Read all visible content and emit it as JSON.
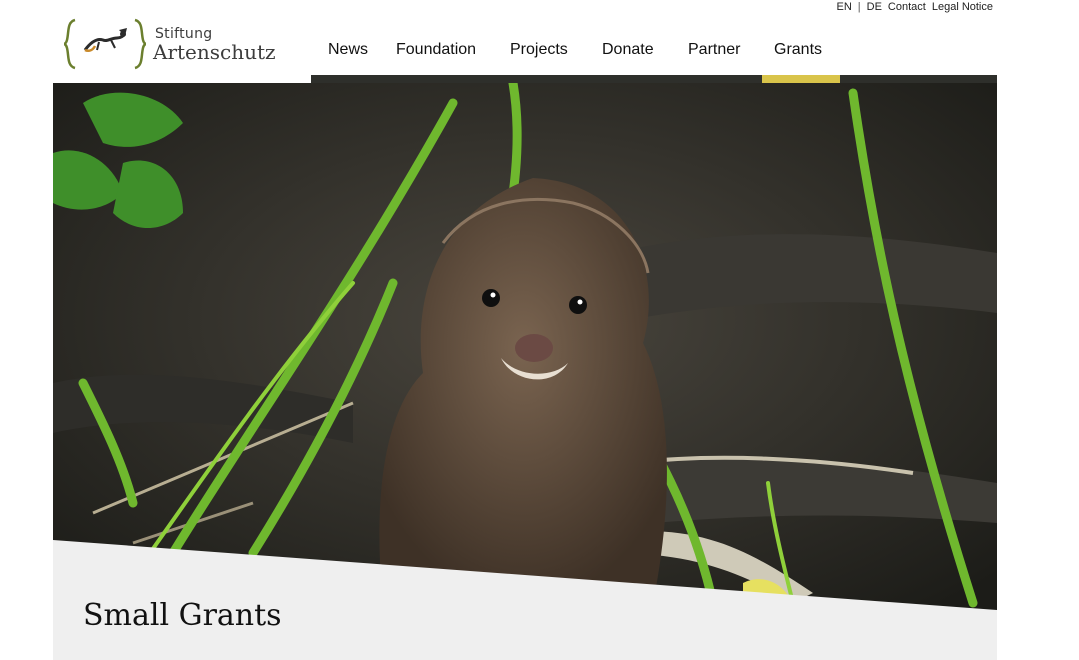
{
  "topbar": {
    "lang_en": "EN",
    "lang_separator": "|",
    "lang_de": "DE",
    "contact": "Contact",
    "legal": "Legal Notice"
  },
  "logo": {
    "line1": "Stiftung",
    "line2": "Artenschutz"
  },
  "nav": {
    "items": [
      "News",
      "Foundation",
      "Projects",
      "Donate",
      "Partner",
      "Grants"
    ],
    "active": "Grants"
  },
  "hero": {
    "subject": "mink-in-grass-photo"
  },
  "content": {
    "title": "Small Grants"
  },
  "colors": {
    "accent": "#d9c44a",
    "navbar": "#2e2f2b",
    "logo_green": "#6b7f2e",
    "content_bg": "#efefef"
  }
}
